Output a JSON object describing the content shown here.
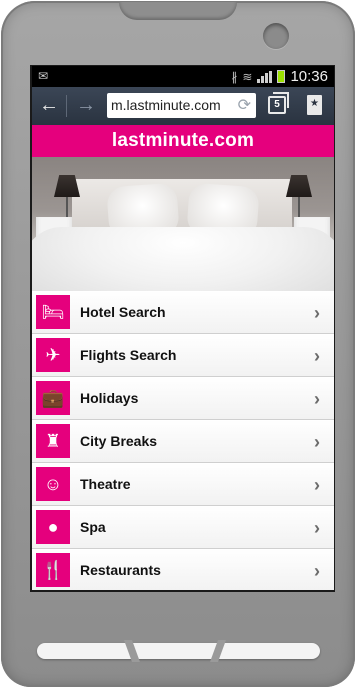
{
  "status_bar": {
    "time": "10:36",
    "left_icon": "mail-icon",
    "icons": [
      "bluetooth-icon",
      "wifi-icon",
      "signal-icon",
      "battery-icon"
    ]
  },
  "browser": {
    "url": "m.lastminute.com",
    "tab_count": "5"
  },
  "brand": {
    "name": "lastminute.com",
    "color": "#e5007d"
  },
  "menu": {
    "items": [
      {
        "label": "Hotel Search",
        "icon": "bed-icon",
        "glyph": "🛏"
      },
      {
        "label": "Flights Search",
        "icon": "airplane-icon",
        "glyph": "✈"
      },
      {
        "label": "Holidays",
        "icon": "suitcase-icon",
        "glyph": "💼"
      },
      {
        "label": "City Breaks",
        "icon": "eiffel-tower-icon",
        "glyph": "♜"
      },
      {
        "label": "Theatre",
        "icon": "theatre-masks-icon",
        "glyph": "☺"
      },
      {
        "label": "Spa",
        "icon": "spa-stones-icon",
        "glyph": "●"
      },
      {
        "label": "Restaurants",
        "icon": "cutlery-icon",
        "glyph": "🍴"
      }
    ]
  }
}
